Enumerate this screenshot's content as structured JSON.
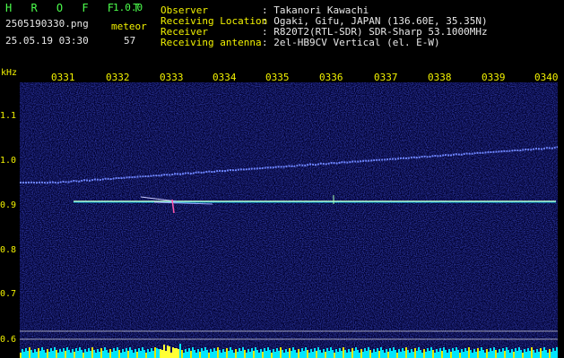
{
  "header": {
    "app_name": "H R O F F T",
    "version": "1.0.0",
    "filename": "2505190330.png",
    "meteor_label": "meteor",
    "datetime": "25.05.19 03:30",
    "meteor_count": "57"
  },
  "station": {
    "observer_label": "Observer",
    "observer_value": ": Takanori Kawachi",
    "location_label": "Receiving Location",
    "location_value": ": Ogaki, Gifu, JAPAN (136.60E, 35.35N)",
    "receiver_label": "Receiver",
    "receiver_value": ": R820T2(RTL-SDR) SDR-Sharp 53.1000MHz",
    "antenna_label": "Receiving antenna",
    "antenna_value": ": 2el-HB9CV Vertical (el. E-W)"
  },
  "axes": {
    "y_unit": "kHz",
    "x_ticks": [
      "0331",
      "0332",
      "0333",
      "0334",
      "0335",
      "0336",
      "0337",
      "0338",
      "0339",
      "0340"
    ],
    "y_ticks": [
      "1.1",
      "1.0",
      "0.9",
      "0.8",
      "0.7",
      "0.6"
    ]
  },
  "colors": {
    "label_yellow": "#f2f200",
    "text_white": "#e8e8e8",
    "version_green": "#4cff4c",
    "signal_cyan": "#00e5ff"
  }
}
